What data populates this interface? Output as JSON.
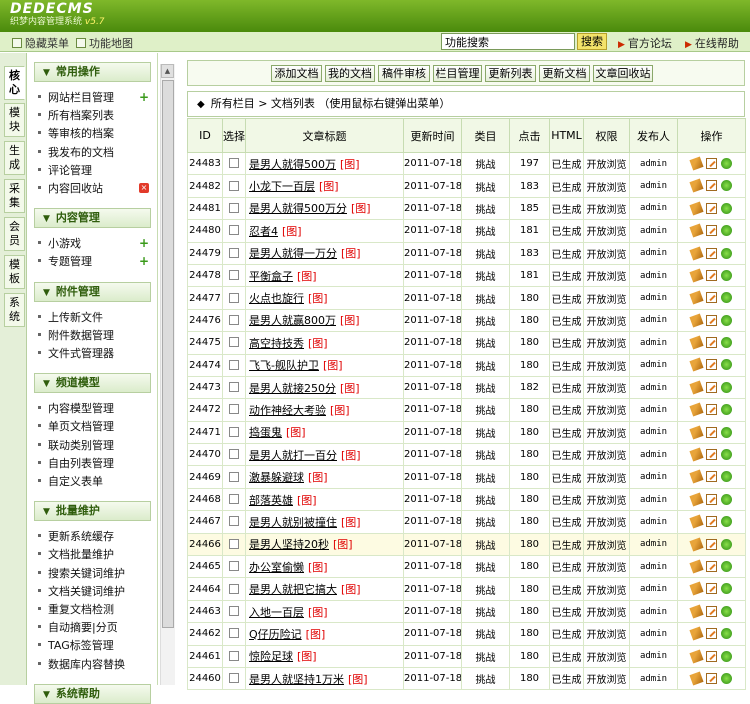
{
  "header": {
    "logo_text": "DEDECMS",
    "logo_subtitle": "织梦内容管理系统",
    "logo_version": "v5.7"
  },
  "subbar": {
    "hide_menu": "隐藏菜单",
    "function_map": "功能地图",
    "search_value": "功能搜索",
    "search_button": "搜索",
    "forum_link": "官方论坛",
    "help_link": "在线帮助"
  },
  "left_tabs": [
    "核心",
    "模块",
    "生成",
    "采集",
    "会员",
    "模板",
    "系统"
  ],
  "menu": {
    "sections": [
      {
        "title": "常用操作",
        "items": [
          "网站栏目管理",
          "所有档案列表",
          "等审核的档案",
          "我发布的文档",
          "评论管理",
          "内容回收站"
        ]
      },
      {
        "title": "内容管理",
        "items": [
          "小游戏",
          "专题管理"
        ]
      },
      {
        "title": "附件管理",
        "items": [
          "上传新文件",
          "附件数据管理",
          "文件式管理器"
        ]
      },
      {
        "title": "频道模型",
        "items": [
          "内容模型管理",
          "单页文档管理",
          "联动类别管理",
          "自由列表管理",
          "自定义表单"
        ]
      },
      {
        "title": "批量维护",
        "items": [
          "更新系统缓存",
          "文档批量维护",
          "搜索关键词维护",
          "文档关键词维护",
          "重复文档检测",
          "自动摘要|分页",
          "TAG标签管理",
          "数据库内容替换"
        ]
      },
      {
        "title": "系统帮助",
        "items": []
      }
    ]
  },
  "toolbar": {
    "buttons": [
      "添加文档",
      "我的文档",
      "稿件审核",
      "栏目管理",
      "更新列表",
      "更新文档",
      "文章回收站"
    ]
  },
  "list": {
    "title": "所有栏目 > 文档列表  （使用鼠标右键弹出菜单）",
    "columns": [
      "ID",
      "选择",
      "文章标题",
      "更新时间",
      "类目",
      "点击",
      "HTML",
      "权限",
      "发布人",
      "操作"
    ],
    "img_tag": "[图]",
    "rows": [
      [
        "24483",
        "是男人就得500万",
        "2011-07-18",
        "挑战",
        "197",
        "已生成",
        "开放浏览",
        "admin"
      ],
      [
        "24482",
        "小龙下一百层",
        "2011-07-18",
        "挑战",
        "183",
        "已生成",
        "开放浏览",
        "admin"
      ],
      [
        "24481",
        "是男人就得500万分",
        "2011-07-18",
        "挑战",
        "185",
        "已生成",
        "开放浏览",
        "admin"
      ],
      [
        "24480",
        "忍者4",
        "2011-07-18",
        "挑战",
        "181",
        "已生成",
        "开放浏览",
        "admin"
      ],
      [
        "24479",
        "是男人就得一万分",
        "2011-07-18",
        "挑战",
        "183",
        "已生成",
        "开放浏览",
        "admin"
      ],
      [
        "24478",
        "平衡盒子",
        "2011-07-18",
        "挑战",
        "181",
        "已生成",
        "开放浏览",
        "admin"
      ],
      [
        "24477",
        "火点也旋行",
        "2011-07-18",
        "挑战",
        "180",
        "已生成",
        "开放浏览",
        "admin"
      ],
      [
        "24476",
        "是男人就赢800万",
        "2011-07-18",
        "挑战",
        "180",
        "已生成",
        "开放浏览",
        "admin"
      ],
      [
        "24475",
        "高空持技秀",
        "2011-07-18",
        "挑战",
        "180",
        "已生成",
        "开放浏览",
        "admin"
      ],
      [
        "24474",
        "飞飞-舰队护卫",
        "2011-07-18",
        "挑战",
        "180",
        "已生成",
        "开放浏览",
        "admin"
      ],
      [
        "24473",
        "是男人就接250分",
        "2011-07-18",
        "挑战",
        "182",
        "已生成",
        "开放浏览",
        "admin"
      ],
      [
        "24472",
        "动作神经大考验",
        "2011-07-18",
        "挑战",
        "180",
        "已生成",
        "开放浏览",
        "admin"
      ],
      [
        "24471",
        "捣蛋鬼",
        "2011-07-18",
        "挑战",
        "180",
        "已生成",
        "开放浏览",
        "admin"
      ],
      [
        "24470",
        "是男人就打一百分",
        "2011-07-18",
        "挑战",
        "180",
        "已生成",
        "开放浏览",
        "admin"
      ],
      [
        "24469",
        "激暴躲避球",
        "2011-07-18",
        "挑战",
        "180",
        "已生成",
        "开放浏览",
        "admin"
      ],
      [
        "24468",
        "部落英雄",
        "2011-07-18",
        "挑战",
        "180",
        "已生成",
        "开放浏览",
        "admin"
      ],
      [
        "24467",
        "是男人就别被撞住",
        "2011-07-18",
        "挑战",
        "180",
        "已生成",
        "开放浏览",
        "admin"
      ],
      [
        "24466",
        "是男人坚持20秒",
        "2011-07-18",
        "挑战",
        "180",
        "已生成",
        "开放浏览",
        "admin"
      ],
      [
        "24465",
        "办公室偷懒",
        "2011-07-18",
        "挑战",
        "180",
        "已生成",
        "开放浏览",
        "admin"
      ],
      [
        "24464",
        "是男人就把它搞大",
        "2011-07-18",
        "挑战",
        "180",
        "已生成",
        "开放浏览",
        "admin"
      ],
      [
        "24463",
        "入地一百层",
        "2011-07-18",
        "挑战",
        "180",
        "已生成",
        "开放浏览",
        "admin"
      ],
      [
        "24462",
        "Q仔历险记",
        "2011-07-18",
        "挑战",
        "180",
        "已生成",
        "开放浏览",
        "admin"
      ],
      [
        "24461",
        "惊险足球",
        "2011-07-18",
        "挑战",
        "180",
        "已生成",
        "开放浏览",
        "admin"
      ],
      [
        "24460",
        "是男人就坚持1万米",
        "2011-07-18",
        "挑战",
        "180",
        "已生成",
        "开放浏览",
        "admin"
      ]
    ],
    "highlighted_id": "24466"
  }
}
